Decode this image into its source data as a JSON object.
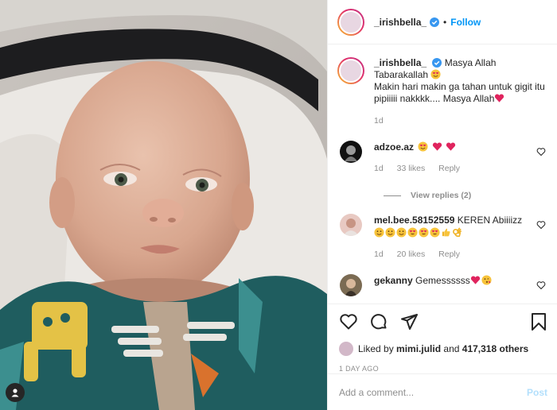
{
  "post": {
    "username": "_irishbella_",
    "follow_label": "Follow",
    "caption_line1": "Masya Allah",
    "caption_line2": "Tabarakallah",
    "caption_line3": "Makin hari makin ga tahan untuk gigit itu pipiiiii nakkkk.... Masya Allah",
    "caption_age": "1d"
  },
  "comments": [
    {
      "user": "adzoe.az",
      "text": "",
      "emoji": [
        "smiling-heart-eyes-emoji",
        "red-heart-emoji",
        "red-heart-emoji"
      ],
      "age": "1d",
      "likes": "33 likes",
      "reply_label": "Reply",
      "view_replies": "View replies (2)"
    },
    {
      "user": "mel.bee.58152559",
      "text": "KEREN Abiiiizz",
      "emoji": [
        "grinning-emoji",
        "grinning-emoji",
        "grinning-emoji",
        "heart-eyes-emoji",
        "heart-eyes-emoji",
        "heart-eyes-emoji",
        "thumbs-up-emoji",
        "ok-hand-emoji"
      ],
      "age": "1d",
      "likes": "20 likes",
      "reply_label": "Reply"
    },
    {
      "user": "gekanny",
      "text": "Gemessssss",
      "emoji": [
        "red-heart-emoji",
        "kissing-emoji"
      ]
    }
  ],
  "footer": {
    "liked_prefix": "Liked by",
    "liked_user": "mimi.julid",
    "liked_and": "and",
    "liked_count": "417,318 others",
    "date": "1 DAY AGO",
    "comment_placeholder": "Add a comment...",
    "post_label": "Post"
  },
  "colors": {
    "accent_blue": "#0095f6",
    "muted_text": "#8e8e8e",
    "heart_red": "#e0245e",
    "divider": "#efefef"
  }
}
